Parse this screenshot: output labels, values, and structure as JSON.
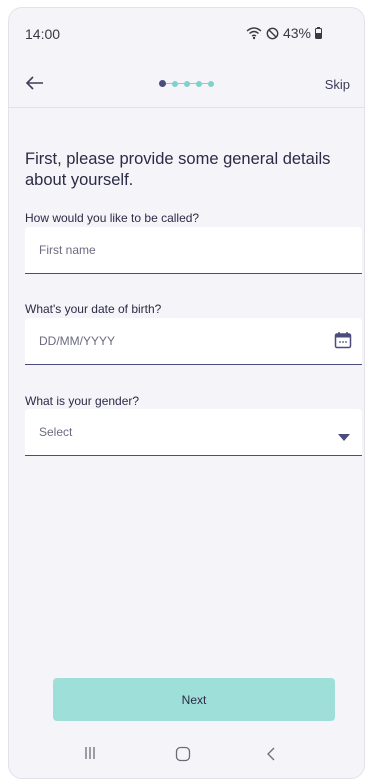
{
  "status": {
    "time": "14:00",
    "battery": "43%"
  },
  "app_bar": {
    "skip_label": "Skip",
    "progress_steps": 5,
    "current_step": 1
  },
  "heading": "First, please provide some general details about yourself.",
  "fields": {
    "name": {
      "label": "How would you like to be called?",
      "placeholder": "First name"
    },
    "dob": {
      "label": "What's your date of birth?",
      "placeholder": "DD/MM/YYYY"
    },
    "gender": {
      "label": "What is your gender?",
      "value": "Select"
    }
  },
  "next_label": "Next",
  "colors": {
    "accent": "#4b4b7e",
    "teal": "#7fd1cc",
    "button": "#9fdfd9",
    "background": "#f5f4f9"
  }
}
